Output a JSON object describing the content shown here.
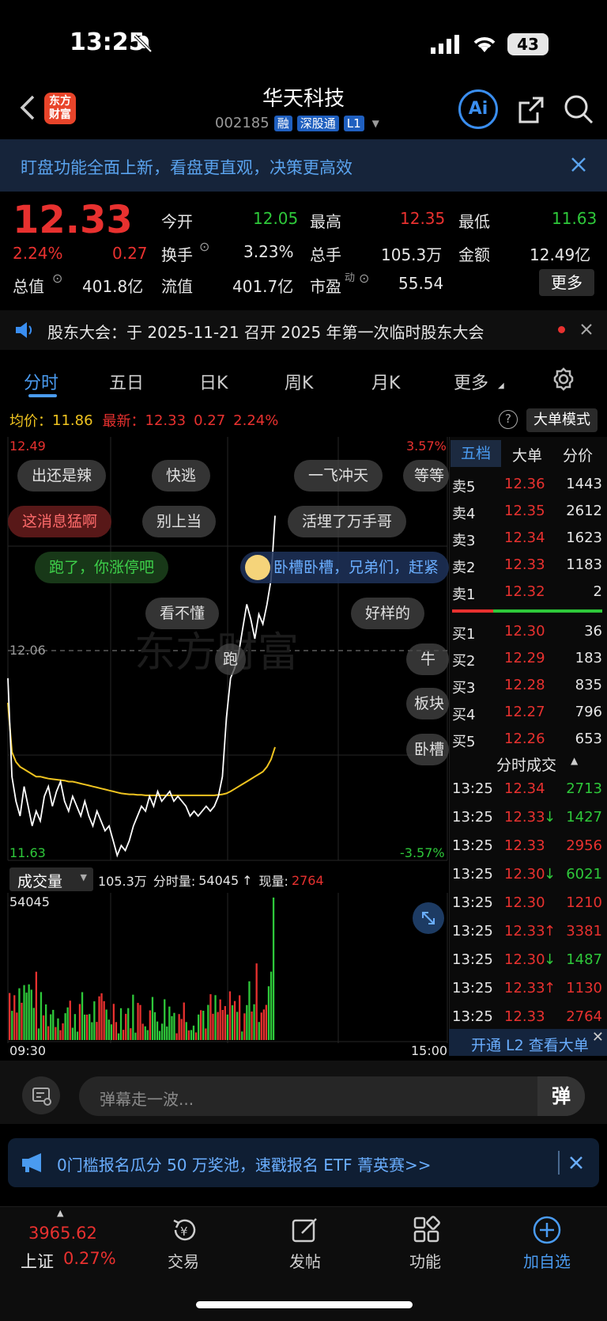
{
  "status": {
    "time": "13:25",
    "battery": "43"
  },
  "header": {
    "title": "华天科技",
    "code": "002185",
    "tags": [
      "融",
      "深股通",
      "L1"
    ],
    "logo": "东方\n财富"
  },
  "banner": {
    "text": "盯盘功能全面上新，看盘更直观，决策更高效"
  },
  "quote": {
    "price": "12.33",
    "pct": "2.24%",
    "chg": "0.27",
    "open_label": "今开",
    "open": "12.05",
    "high_label": "最高",
    "high": "12.35",
    "low_label": "最低",
    "low": "11.63",
    "turnover_label": "换手",
    "turnover": "3.23%",
    "vol_label": "总手",
    "vol": "105.3万",
    "amount_label": "金额",
    "amount": "12.49亿",
    "mcap_label": "总值",
    "mcap": "401.8亿",
    "float_label": "流值",
    "float": "401.7亿",
    "pe_label": "市盈",
    "pe_sup": "动",
    "pe": "55.54",
    "more": "更多"
  },
  "notice": {
    "text": "股东大会：于 2025-11-21 召开 2025 年第一次临时股东大会"
  },
  "tabs": [
    "分时",
    "五日",
    "日K",
    "周K",
    "月K",
    "更多"
  ],
  "chart_info": {
    "avg_label": "均价：",
    "avg": "11.86",
    "latest_label": "最新：",
    "latest": "12.33",
    "latest_chg": "0.27",
    "latest_pct": "2.24%",
    "mode": "大单模式"
  },
  "chart_data": {
    "type": "line",
    "y_top": "12.49",
    "y_mid": "12.06",
    "y_bottom": "11.63",
    "pct_top": "3.57%",
    "pct_bottom": "-3.57%",
    "ylim": [
      11.63,
      12.49
    ],
    "series": [],
    "price": [
      12.0,
      11.8,
      11.75,
      11.72,
      11.78,
      11.74,
      11.7,
      11.73,
      11.71,
      11.76,
      11.78,
      11.74,
      11.77,
      11.79,
      11.75,
      11.73,
      11.76,
      11.74,
      11.72,
      11.75,
      11.72,
      11.7,
      11.73,
      11.71,
      11.69,
      11.7,
      11.67,
      11.64,
      11.66,
      11.65,
      11.67,
      11.7,
      11.72,
      11.74,
      11.73,
      11.76,
      11.74,
      11.77,
      11.75,
      11.76,
      11.77,
      11.75,
      11.76,
      11.75,
      11.74,
      11.72,
      11.73,
      11.72,
      11.73,
      11.74,
      11.73,
      11.74,
      11.76,
      11.8,
      11.92,
      12.0,
      12.02,
      12.05,
      12.1,
      12.15,
      12.12,
      12.08,
      12.13,
      12.11,
      12.15,
      12.2,
      12.33
    ],
    "avg": [
      11.95,
      11.85,
      11.83,
      11.82,
      11.815,
      11.81,
      11.805,
      11.8,
      11.8,
      11.798,
      11.796,
      11.795,
      11.794,
      11.793,
      11.792,
      11.79,
      11.79,
      11.788,
      11.786,
      11.784,
      11.782,
      11.78,
      11.778,
      11.776,
      11.774,
      11.772,
      11.77,
      11.768,
      11.766,
      11.765,
      11.764,
      11.764,
      11.763,
      11.763,
      11.762,
      11.762,
      11.762,
      11.762,
      11.762,
      11.762,
      11.762,
      11.762,
      11.762,
      11.762,
      11.762,
      11.762,
      11.762,
      11.762,
      11.762,
      11.762,
      11.762,
      11.762,
      11.763,
      11.764,
      11.766,
      11.77,
      11.775,
      11.78,
      11.785,
      11.79,
      11.795,
      11.8,
      11.805,
      11.81,
      11.82,
      11.835,
      11.86
    ],
    "volume_label": "成交量",
    "volume_total": "105.3万",
    "minute_vol_label": "分时量:",
    "minute_vol": "54045",
    "now_vol_label": "现量:",
    "now_vol": "2764",
    "vol_max": "54045",
    "time_start": "09:30",
    "time_end": "15:00"
  },
  "bubbles": [
    "出还是辣",
    "快逃",
    "一飞冲天",
    "等等",
    "这消息猛啊",
    "别上当",
    "活埋了万手哥",
    "跑了，你涨停吧",
    "卧槽卧槽，兄弟们，赶紧",
    "看不懂",
    "好样的",
    "跑",
    "牛",
    "板块",
    "卧槽"
  ],
  "orderbook": {
    "tabs": [
      "五档",
      "大单",
      "分价"
    ],
    "asks": [
      {
        "label": "卖5",
        "price": "12.36",
        "vol": "1443"
      },
      {
        "label": "卖4",
        "price": "12.35",
        "vol": "2612"
      },
      {
        "label": "卖3",
        "price": "12.34",
        "vol": "1623"
      },
      {
        "label": "卖2",
        "price": "12.33",
        "vol": "1183"
      },
      {
        "label": "卖1",
        "price": "12.32",
        "vol": "2"
      }
    ],
    "bids": [
      {
        "label": "买1",
        "price": "12.30",
        "vol": "36"
      },
      {
        "label": "买2",
        "price": "12.29",
        "vol": "183"
      },
      {
        "label": "买3",
        "price": "12.28",
        "vol": "835"
      },
      {
        "label": "买4",
        "price": "12.27",
        "vol": "796"
      },
      {
        "label": "买5",
        "price": "12.26",
        "vol": "653"
      }
    ],
    "trades_title": "分时成交",
    "trades": [
      {
        "time": "13:25",
        "price": "12.34",
        "arrow": "",
        "vol": "2713",
        "pc": "red",
        "vc": "green"
      },
      {
        "time": "13:25",
        "price": "12.33",
        "arrow": "↓",
        "vol": "1427",
        "pc": "red",
        "vc": "green"
      },
      {
        "time": "13:25",
        "price": "12.33",
        "arrow": "",
        "vol": "2956",
        "pc": "red",
        "vc": "red"
      },
      {
        "time": "13:25",
        "price": "12.30",
        "arrow": "↓",
        "vol": "6021",
        "pc": "red",
        "vc": "green"
      },
      {
        "time": "13:25",
        "price": "12.30",
        "arrow": "",
        "vol": "1210",
        "pc": "red",
        "vc": "red"
      },
      {
        "time": "13:25",
        "price": "12.33",
        "arrow": "↑",
        "vol": "3381",
        "pc": "red",
        "vc": "red"
      },
      {
        "time": "13:25",
        "price": "12.30",
        "arrow": "↓",
        "vol": "1487",
        "pc": "red",
        "vc": "green"
      },
      {
        "time": "13:25",
        "price": "12.33",
        "arrow": "↑",
        "vol": "1130",
        "pc": "red",
        "vc": "red"
      },
      {
        "time": "13:25",
        "price": "12.33",
        "arrow": "",
        "vol": "2764",
        "pc": "red",
        "vc": "red"
      }
    ],
    "l2": "开通 L2 查看大单"
  },
  "danmaku": {
    "placeholder": "弹幕走一波...",
    "send": "弹"
  },
  "ad": {
    "text": "0门槛报名瓜分 50 万奖池，速戳报名 ETF 菁英赛>>"
  },
  "tabbar": {
    "index_value": "3965.62",
    "index_name": "上证",
    "index_pct": "0.27%",
    "items": [
      "交易",
      "发帖",
      "功能",
      "加自选"
    ]
  }
}
